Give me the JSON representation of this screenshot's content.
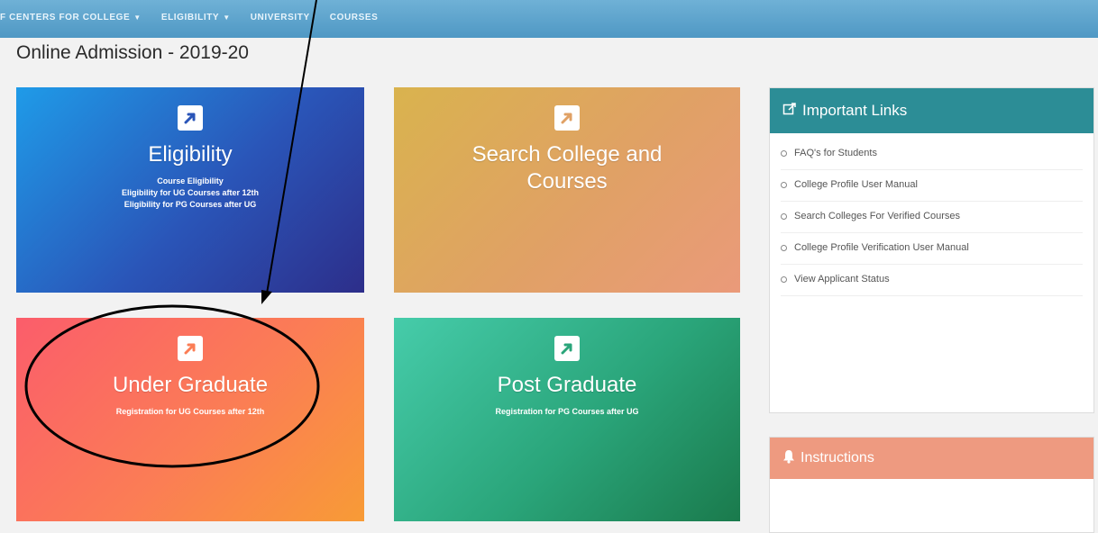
{
  "nav": {
    "items": [
      {
        "label": "F CENTERS FOR COLLEGE",
        "dropdown": true
      },
      {
        "label": "ELIGIBILITY",
        "dropdown": true
      },
      {
        "label": "UNIVERSITY",
        "dropdown": false
      },
      {
        "label": "COURSES",
        "dropdown": false
      }
    ]
  },
  "page_title": "Online Admission - 2019-20",
  "tiles": {
    "eligibility": {
      "title": "Eligibility",
      "lines": [
        "Course Eligibility",
        "Eligibility for UG Courses after 12th",
        "Eligibility for PG Courses after UG"
      ]
    },
    "search": {
      "title_line1": "Search College and",
      "title_line2": "Courses"
    },
    "under_graduate": {
      "title": "Under Graduate",
      "desc": "Registration for UG Courses after 12th"
    },
    "post_graduate": {
      "title": "Post Graduate",
      "desc": "Registration for PG Courses after UG"
    }
  },
  "important_links": {
    "title": "Important Links",
    "items": [
      "FAQ's for Students",
      "College Profile User Manual",
      "Search Colleges For Verified Courses",
      "College Profile Verification User Manual",
      "View Applicant Status"
    ]
  },
  "instructions": {
    "title": "Instructions"
  },
  "icons": {
    "tile_icon": "external-link-icon",
    "links_icon": "edit-link-icon",
    "instructions_icon": "bell-icon"
  },
  "colors": {
    "navbar": "#5aa3cc",
    "eligibility_tile": "#2a55b8",
    "search_tile": "#e0a165",
    "ug_tile": "#fb7d55",
    "pg_tile": "#2aa57a",
    "links_header": "#2c8d96",
    "instructions_header": "#ee9a80"
  }
}
